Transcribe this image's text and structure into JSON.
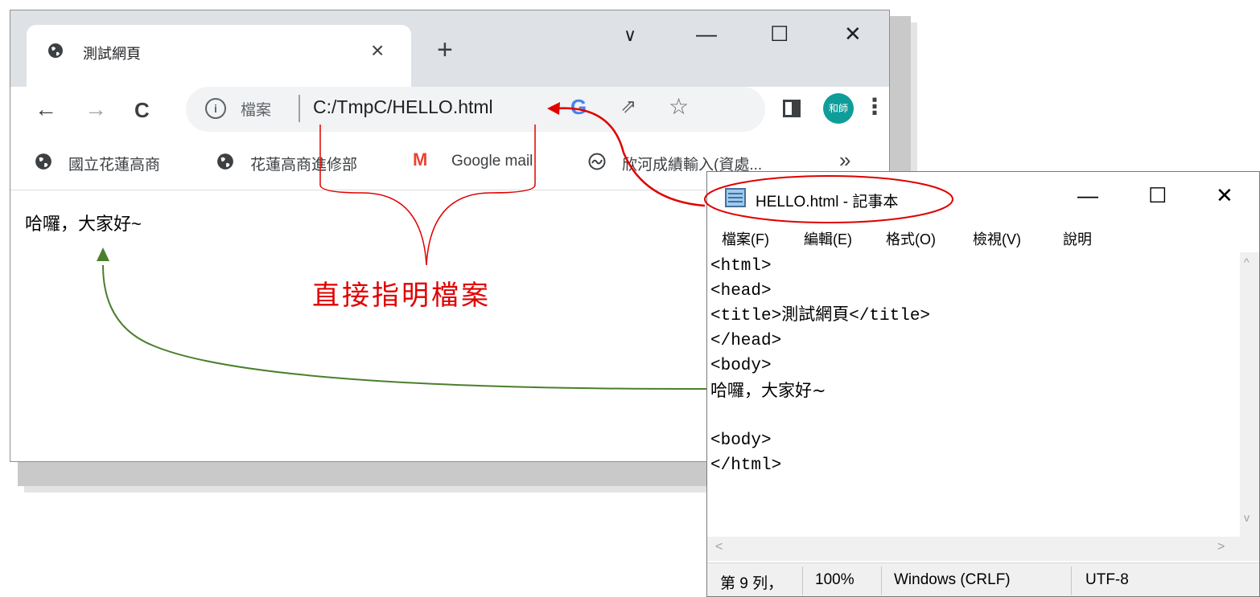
{
  "browser": {
    "tab_title": "測試網頁",
    "tab_close": "×",
    "new_tab": "+",
    "tab_search": "∨",
    "minimize": "—",
    "maximize": "☐",
    "close": "✕",
    "back": "←",
    "forward": "→",
    "reload": "C",
    "info_icon": "i",
    "address_scheme": "檔案",
    "address_url": "C:/TmpC/HELLO.html",
    "google_icon": "G",
    "share_icon": "⇗",
    "star_icon": "☆",
    "avatar_text": "和師",
    "menu_icon": "⋮",
    "bookmarks": [
      "國立花蓮高商",
      "花蓮高商進修部",
      "Google mail",
      "欣河成績輸入(資處..."
    ],
    "bookmarks_more": "»",
    "gmail_letter": "M",
    "page_content": "哈囉，大家好~"
  },
  "notepad": {
    "title": "HELLO.html - 記事本",
    "minimize": "—",
    "maximize": "☐",
    "close": "✕",
    "menu": [
      "檔案(F)",
      "編輯(E)",
      "格式(O)",
      "檢視(V)",
      "說明"
    ],
    "lines": [
      "<html>",
      "<head>",
      "<title>測試網頁</title>",
      "</head>",
      "<body>",
      "哈囉，大家好~",
      "",
      "<body>",
      "</html>"
    ],
    "scroll_up": "^",
    "scroll_down": "v",
    "scroll_left": "<",
    "scroll_right": ">",
    "status": {
      "position": "第 9 列，",
      "zoom": "100%",
      "line_ending": "Windows (CRLF)",
      "encoding": "UTF-8"
    }
  },
  "annotation": {
    "label": "直接指明檔案",
    "label_color": "#e00000",
    "arrow_red": "#e00000",
    "arrow_green": "#4a7f2c"
  }
}
